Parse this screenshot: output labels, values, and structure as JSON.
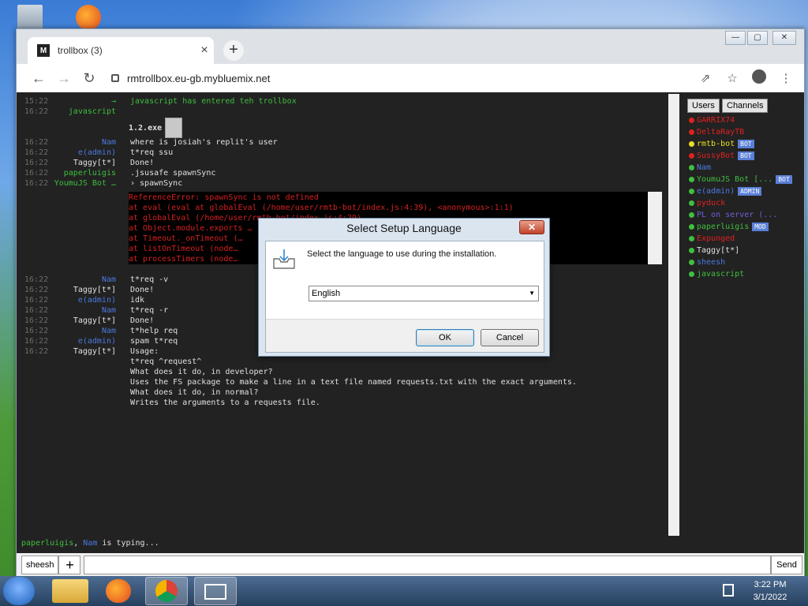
{
  "browser": {
    "tab_title": "trollbox (3)",
    "tab_favicon_text": "M",
    "url": "rmtrollbox.eu-gb.mybluemix.net"
  },
  "chat": {
    "lines": [
      {
        "ts": "15:22",
        "nick": "→",
        "nick_color": "#3fbf3f",
        "text": "javascript has entered teh trollbox",
        "text_color": "#3fbf3f"
      },
      {
        "ts": "16:22",
        "nick": "javascript",
        "nick_color": "#3fbf3f",
        "text": "",
        "text_color": "#e0e0e0"
      },
      {
        "ts": "16:22",
        "nick": "Nam",
        "nick_color": "#4a7ae0",
        "text": "where is josiah's replit's user",
        "text_color": "#e0e0e0"
      },
      {
        "ts": "16:22",
        "nick": "e(admin)",
        "nick_color": "#4a7ae0",
        "text": "t*req ssu",
        "text_color": "#e0e0e0"
      },
      {
        "ts": "16:22",
        "nick": "Taggy[t*]",
        "nick_color": "#e0e0e0",
        "text": "Done!",
        "text_color": "#e0e0e0"
      },
      {
        "ts": "16:22",
        "nick": "paperluigis",
        "nick_color": "#3fbf3f",
        "text": ".jsusafe spawnSync",
        "text_color": "#e0e0e0"
      },
      {
        "ts": "16:22",
        "nick": "YoumuJS Bot …",
        "nick_color": "#3fbf3f",
        "text": "› spawnSync",
        "text_color": "#e0e0e0"
      }
    ],
    "exe_label": "1.2.exe",
    "error_lines": [
      "ReferenceError: spawnSync is not defined",
      "    at eval (eval at globalEval (/home/user/rmtb-bot/index.js:4:39), <anonymous>:1:1)",
      "    at globalEval (/home/user/rmtb-bot/index.js:4:39)",
      "    at Object.module.exports …",
      "    at Timeout._onTimeout (…",
      "    at listOnTimeout (node…",
      "    at processTimers (node…"
    ],
    "lines2": [
      {
        "ts": "16:22",
        "nick": "Nam",
        "nick_color": "#4a7ae0",
        "text": "t*req -v"
      },
      {
        "ts": "16:22",
        "nick": "Taggy[t*]",
        "nick_color": "#e0e0e0",
        "text": "Done!"
      },
      {
        "ts": "16:22",
        "nick": "e(admin)",
        "nick_color": "#4a7ae0",
        "text": "idk"
      },
      {
        "ts": "16:22",
        "nick": "Nam",
        "nick_color": "#4a7ae0",
        "text": "t*req -r"
      },
      {
        "ts": "16:22",
        "nick": "Taggy[t*]",
        "nick_color": "#e0e0e0",
        "text": "Done!"
      },
      {
        "ts": "16:22",
        "nick": "Nam",
        "nick_color": "#4a7ae0",
        "text": "t*help req"
      },
      {
        "ts": "16:22",
        "nick": "e(admin)",
        "nick_color": "#4a7ae0",
        "text": "spam t*req"
      },
      {
        "ts": "16:22",
        "nick": "Taggy[t*]",
        "nick_color": "#e0e0e0",
        "text": "Usage:"
      },
      {
        "ts": "",
        "nick": "",
        "nick_color": "#e0e0e0",
        "text": "t*req ^request^"
      },
      {
        "ts": "",
        "nick": "",
        "nick_color": "#e0e0e0",
        "text": "What does it do, in developer?"
      },
      {
        "ts": "",
        "nick": "",
        "nick_color": "#e0e0e0",
        "text": "Uses the FS package to make a line in a text file named requests.txt with the exact arguments."
      },
      {
        "ts": "",
        "nick": "",
        "nick_color": "#e0e0e0",
        "text": "What does it do, in normal?"
      },
      {
        "ts": "",
        "nick": "",
        "nick_color": "#e0e0e0",
        "text": " Writes the arguments to a requests file."
      }
    ],
    "typing_users_a": "paperluigis",
    "typing_sep": ", ",
    "typing_users_b": "Nam",
    "typing_suffix": "is typing..."
  },
  "sidebar": {
    "tab_users": "Users",
    "tab_channels": "Channels",
    "users": [
      {
        "name": "GARRIX74",
        "color": "#e02020",
        "dot": "#e02020",
        "badge": ""
      },
      {
        "name": "DeltaRayTB",
        "color": "#e02020",
        "dot": "#e02020",
        "badge": ""
      },
      {
        "name": "rmtb-bot",
        "color": "#e8e020",
        "dot": "#e8e020",
        "badge": "BOT"
      },
      {
        "name": "SussyBot",
        "color": "#e02020",
        "dot": "#e02020",
        "badge": "BOT"
      },
      {
        "name": "Nam",
        "color": "#4a7ae0",
        "dot": "#3fbf3f",
        "badge": ""
      },
      {
        "name": "YoumuJS Bot [...",
        "color": "#3fbf3f",
        "dot": "#3fbf3f",
        "badge": "BOT"
      },
      {
        "name": "e(admin)",
        "color": "#4a7ae0",
        "dot": "#3fbf3f",
        "badge": "ADMIN"
      },
      {
        "name": "pyduck",
        "color": "#e02020",
        "dot": "#3fbf3f",
        "badge": ""
      },
      {
        "name": "PL on server (...",
        "color": "#6f5fe0",
        "dot": "#3fbf3f",
        "badge": ""
      },
      {
        "name": "paperluigis",
        "color": "#3fbf3f",
        "dot": "#3fbf3f",
        "badge": "MOD"
      },
      {
        "name": "Expunged",
        "color": "#e02020",
        "dot": "#3fbf3f",
        "badge": ""
      },
      {
        "name": "Taggy[t*]",
        "color": "#e0e0e0",
        "dot": "#3fbf3f",
        "badge": ""
      },
      {
        "name": "sheesh",
        "color": "#4a7ae0",
        "dot": "#3fbf3f",
        "badge": ""
      },
      {
        "name": "javascript",
        "color": "#3fbf3f",
        "dot": "#3fbf3f",
        "badge": ""
      }
    ]
  },
  "bottombar": {
    "room": "sheesh",
    "add": "+",
    "send": "Send"
  },
  "dialog": {
    "title": "Select Setup Language",
    "close": "✕",
    "prompt": "Select the language to use during the installation.",
    "selected_language": "English",
    "ok": "OK",
    "cancel": "Cancel"
  },
  "taskbar": {
    "time": "3:22 PM",
    "date": "3/1/2022"
  }
}
